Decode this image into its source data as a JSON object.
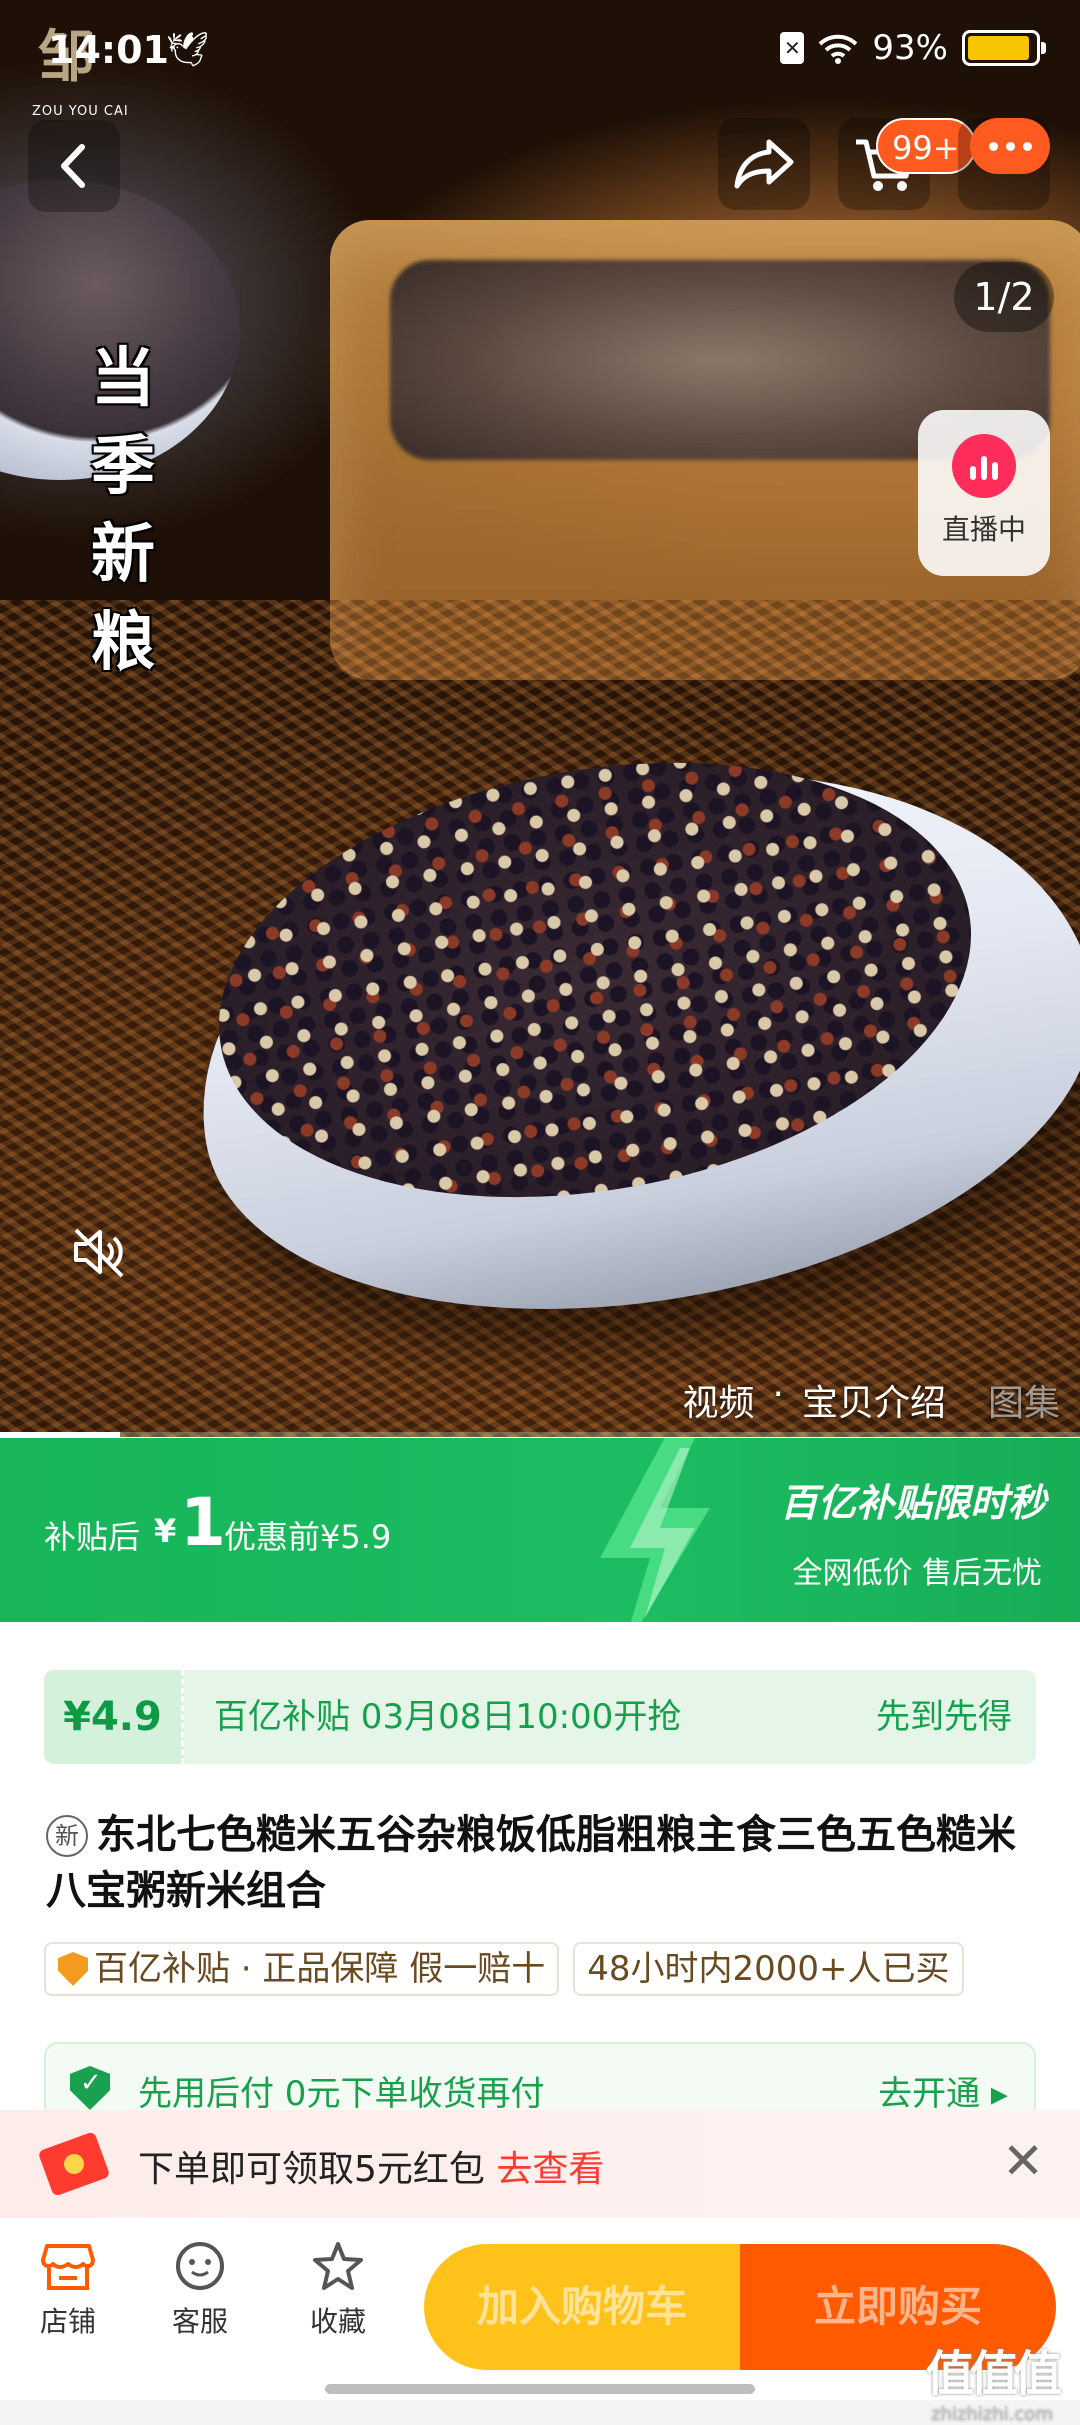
{
  "status_bar": {
    "time": "14:01",
    "battery": "93%",
    "logo_sub": "ZOU YOU CAI"
  },
  "nav": {
    "cart_badge": "99+"
  },
  "hero": {
    "overlay_title": "当季新粮",
    "pager": "1/2",
    "live_label": "直播中"
  },
  "media_tabs": {
    "video": "视频",
    "separator": "·",
    "intro": "宝贝介绍",
    "gallery": "图集"
  },
  "promo": {
    "after_label": "补贴后",
    "currency": "¥",
    "price": "1",
    "before_label": "优惠前¥5.9",
    "slogan": "百亿补贴限时秒",
    "sub": "全网低价 售后无忧"
  },
  "subsidy": {
    "price": "¥4.9",
    "info": "百亿补贴 03月08日10:00开抢",
    "first": "先到先得"
  },
  "product": {
    "badge": "新",
    "title": "东北七色糙米五谷杂粮饭低脂粗粮主食三色五色糙米八宝粥新米组合"
  },
  "tags": {
    "guarantee": "百亿补贴 · 正品保障 假一赔十",
    "sold": "48小时内2000+人已买"
  },
  "pay_later": {
    "text": "先用后付  0元下单收货再付",
    "action": "去开通 ▸"
  },
  "red_packet": {
    "text": "下单即可领取5元红包 ",
    "link": "去查看",
    "close": "✕"
  },
  "bottom_bar": {
    "shop": "店铺",
    "service": "客服",
    "favorite": "收藏",
    "add_cart": "加入购物车",
    "buy_now": "立即购买"
  },
  "watermark": {
    "big": "值值值",
    "small": "zhizhizhi.com"
  },
  "colors": {
    "promo_green": "#1cbc62",
    "cart_yellow": "#ffc21a",
    "buy_orange": "#ff5a00",
    "accent_red": "#ff3b30"
  }
}
